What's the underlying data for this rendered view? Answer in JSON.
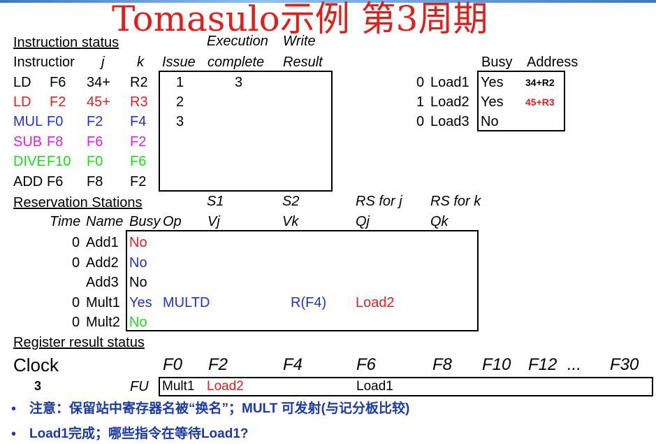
{
  "title": "Tomasulo示例 第3周期",
  "instruction_status": {
    "heading": "Instruction status",
    "col_execution": "Execution",
    "col_write": "Write",
    "col_instruction": "Instructior",
    "col_j": "j",
    "col_k": "k",
    "col_issue": "Issue",
    "col_complete": "complete",
    "col_result": "Result",
    "rows": [
      {
        "op": "LD",
        "dst": "F6",
        "j": "34+",
        "k": "R2",
        "issue": "1",
        "complete": "3",
        "result": "",
        "color": "#000000"
      },
      {
        "op": "LD",
        "dst": "F2",
        "j": "45+",
        "k": "R3",
        "issue": "2",
        "complete": "",
        "result": "",
        "color": "#e81e1e"
      },
      {
        "op": "MUL",
        "dst": "F0",
        "j": "F2",
        "k": "F4",
        "issue": "3",
        "complete": "",
        "result": "",
        "color": "#1e32d8"
      },
      {
        "op": "SUB",
        "dst": "F8",
        "j": "F6",
        "k": "F2",
        "issue": "",
        "complete": "",
        "result": "",
        "color": "#e020e0"
      },
      {
        "op": "DIVE",
        "dst": "F10",
        "j": "F0",
        "k": "F6",
        "issue": "",
        "complete": "",
        "result": "",
        "color": "#18e018"
      },
      {
        "op": "ADD",
        "dst": "F6",
        "j": "F8",
        "k": "F2",
        "issue": "",
        "complete": "",
        "result": "",
        "color": "#000000"
      }
    ]
  },
  "load_buffers": {
    "col_busy": "Busy",
    "col_address": "Address",
    "rows": [
      {
        "time": "0",
        "name": "Load1",
        "busy": "Yes",
        "address": "34+R2",
        "address_color": "#000000"
      },
      {
        "time": "1",
        "name": "Load2",
        "busy": "Yes",
        "address": "45+R3",
        "address_color": "#e81e1e"
      },
      {
        "time": "0",
        "name": "Load3",
        "busy": "No",
        "address": "",
        "address_color": "#000000"
      }
    ]
  },
  "reservation_stations": {
    "heading": "Reservation Stations",
    "col_s1": "S1",
    "col_s2": "S2",
    "col_rsj": "RS for j",
    "col_rsk": "RS for k",
    "col_time": "Time",
    "col_name": "Name",
    "col_busy": "Busy",
    "col_op": "Op",
    "col_vj": "Vj",
    "col_vk": "Vk",
    "col_qj": "Qj",
    "col_qk": "Qk",
    "rows": [
      {
        "time": "0",
        "name": "Add1",
        "busy": "No",
        "busy_color": "#e81e1e",
        "op": "",
        "vj": "",
        "vk": "",
        "qj": "",
        "qk": ""
      },
      {
        "time": "0",
        "name": "Add2",
        "busy": "No",
        "busy_color": "#1e32d8",
        "op": "",
        "vj": "",
        "vk": "",
        "qj": "",
        "qk": ""
      },
      {
        "time": "",
        "name": "Add3",
        "busy": "No",
        "busy_color": "#000000",
        "op": "",
        "vj": "",
        "vk": "",
        "qj": "",
        "qk": ""
      },
      {
        "time": "0",
        "name": "Mult1",
        "busy": "Yes",
        "busy_color": "#1e32d8",
        "op": "MULTD",
        "vj": "",
        "vk": "R(F4)",
        "qj": "Load2",
        "qk": ""
      },
      {
        "time": "0",
        "name": "Mult2",
        "busy": "No",
        "busy_color": "#18e018",
        "op": "",
        "vj": "",
        "vk": "",
        "qj": "",
        "qk": ""
      }
    ]
  },
  "register_status": {
    "heading": "Register result status",
    "clock_label": "Clock",
    "clock_value": "3",
    "fu_label": "FU",
    "registers": [
      "F0",
      "F2",
      "F4",
      "F6",
      "F8",
      "F10",
      "F12",
      "...",
      "F30"
    ],
    "fu_values": [
      "Mult1",
      "Load2",
      "",
      "Load1",
      "",
      "",
      "",
      "",
      ""
    ]
  },
  "notes": [
    "注意：保留站中寄存器名被“换名”；MULT 可发射(与记分板比较)",
    "Load1完成；哪些指令在等待Load1?"
  ],
  "colors": {
    "title": "#e0201a",
    "red": "#e81e1e",
    "blue": "#1e32d8",
    "magenta": "#e020e0",
    "green": "#18e018",
    "note_text": "#1a3aa8"
  }
}
